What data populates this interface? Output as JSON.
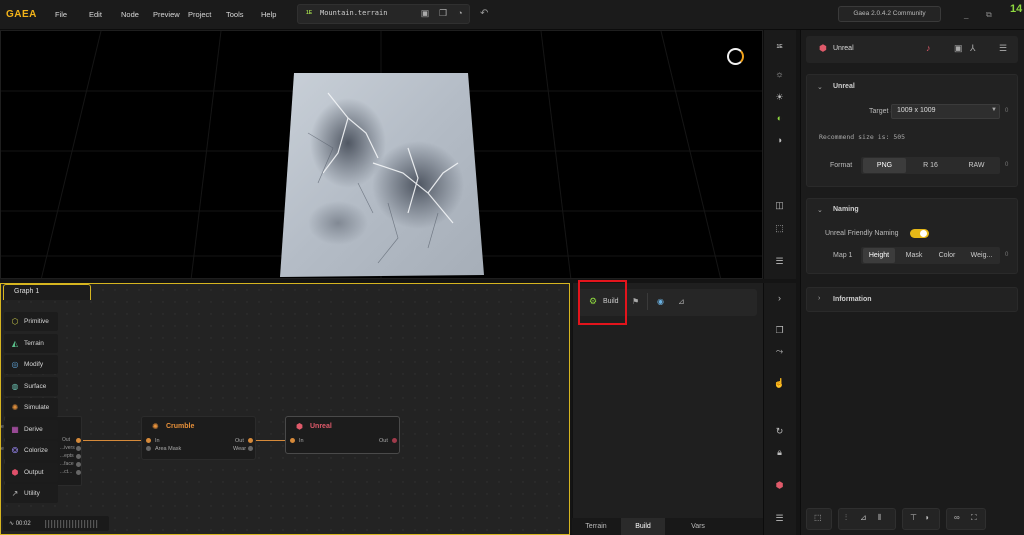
{
  "app": {
    "logo": "GAEA",
    "version": "Gaea 2.0.4.2 Community",
    "fps": "14"
  },
  "menu": [
    "File",
    "Edit",
    "Node",
    "Preview",
    "Project",
    "Tools",
    "Help"
  ],
  "file": {
    "badge": "1E",
    "name": "Mountain.terrain"
  },
  "viewport_toolbar": {
    "top_label": "1E"
  },
  "graph": {
    "tab_label": "Graph 1",
    "palette": [
      {
        "label": "Primitive",
        "icon": "primitive-icon",
        "color": "#c9c94a"
      },
      {
        "label": "Terrain",
        "icon": "terrain-icon",
        "color": "#59c08a"
      },
      {
        "label": "Modify",
        "icon": "modify-icon",
        "color": "#5fa3d6"
      },
      {
        "label": "Surface",
        "icon": "surface-icon",
        "color": "#6ac0b0"
      },
      {
        "label": "Simulate",
        "icon": "simulate-icon",
        "color": "#d88a3a"
      },
      {
        "label": "Derive",
        "icon": "derive-icon",
        "color": "#c55ac0"
      },
      {
        "label": "Colorize",
        "icon": "colorize-icon",
        "color": "#8a7ad8"
      },
      {
        "label": "Output",
        "icon": "output-icon",
        "color": "#e0506a"
      },
      {
        "label": "Utility",
        "icon": "utility-icon",
        "color": "#bbbbbb"
      }
    ],
    "hidden_node": {
      "out": "Out",
      "ports": [
        "...ivers",
        "...epts",
        "...face",
        "...ct..."
      ],
      "left_labels": [
        "en",
        "ea"
      ]
    },
    "nodes": {
      "crumble": {
        "title": "Crumble",
        "color": "#e8913a",
        "in": [
          "In",
          "Area Mask"
        ],
        "out": [
          "Out",
          "Wear"
        ]
      },
      "unreal": {
        "title": "Unreal",
        "color": "#e05a6a",
        "in": [
          "In"
        ],
        "out": [
          "Out"
        ]
      }
    },
    "time": "00:02"
  },
  "build_panel": {
    "build_label": "Build",
    "tabs": [
      "Terrain",
      "Build",
      "Vars"
    ],
    "active_tab": "Build"
  },
  "right_panel": {
    "title": "Unreal",
    "sections": {
      "unreal": {
        "title": "Unreal",
        "target_size_label": "Target Size",
        "target_size_value": "1009 x 1009",
        "recommend": "Recommend size is: 505",
        "format_label": "Format",
        "format_options": [
          "PNG",
          "R 16",
          "RAW"
        ],
        "format_selected": "PNG"
      },
      "naming": {
        "title": "Naming",
        "friendly_label": "Unreal Friendly Naming",
        "friendly_on": true,
        "map_label": "Map 1",
        "map_options": [
          "Height",
          "Mask",
          "Color",
          "Weig..."
        ],
        "map_selected": "Height"
      },
      "information": {
        "title": "Information"
      }
    },
    "zero": "0"
  },
  "colors": {
    "accent": "#f2b319",
    "highlight": "#e3141c",
    "graph_border": "#d6b520"
  }
}
